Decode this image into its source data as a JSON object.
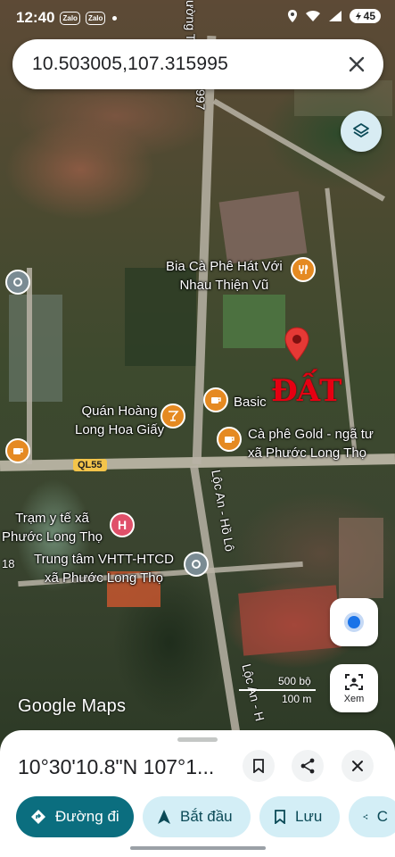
{
  "status_bar": {
    "time": "12:40",
    "notif_1": "Zalo",
    "notif_2": "Zalo",
    "battery": "45"
  },
  "search": {
    "query": "10.503005,107.315995"
  },
  "map": {
    "pois": {
      "bia_ca_phe": "Bia Cà Phê Hát Với\nNhau Thiện Vũ",
      "basic": "Basic",
      "quan_hoang": "Quán Hoàng\nLong Hoa Giấy",
      "ca_phe_gold": "Cà phê Gold - ngã tư\nxã Phước Long Thọ",
      "tram_y_te": "Trạm y tế xã\nPhước Long Thọ",
      "trung_tam": "Trung tâm VHTT-HTCD\nxã Phước Long Thọ"
    },
    "annotation": "ĐẤT",
    "road_shield": "QL55",
    "road_loc_an_1": "Lộc An - Hồ Lô",
    "road_loc_an_2": "Lộc An - H",
    "road_top_1": "ường T",
    "road_top_2": "997",
    "left_edge_num": "18",
    "scale_ft": "500 bộ",
    "scale_m": "100 m",
    "logo": "Google Maps",
    "xem_label": "Xem"
  },
  "sheet": {
    "coords": "10°30'10.8\"N 107°1...",
    "buttons": {
      "directions": "Đường đi",
      "start": "Bắt đầu",
      "save": "Lưu",
      "share": "C"
    }
  },
  "colors": {
    "primary": "#0b6e7f",
    "chip": "#d3eef6",
    "pin": "#e53935",
    "annotation": "#e60012"
  }
}
